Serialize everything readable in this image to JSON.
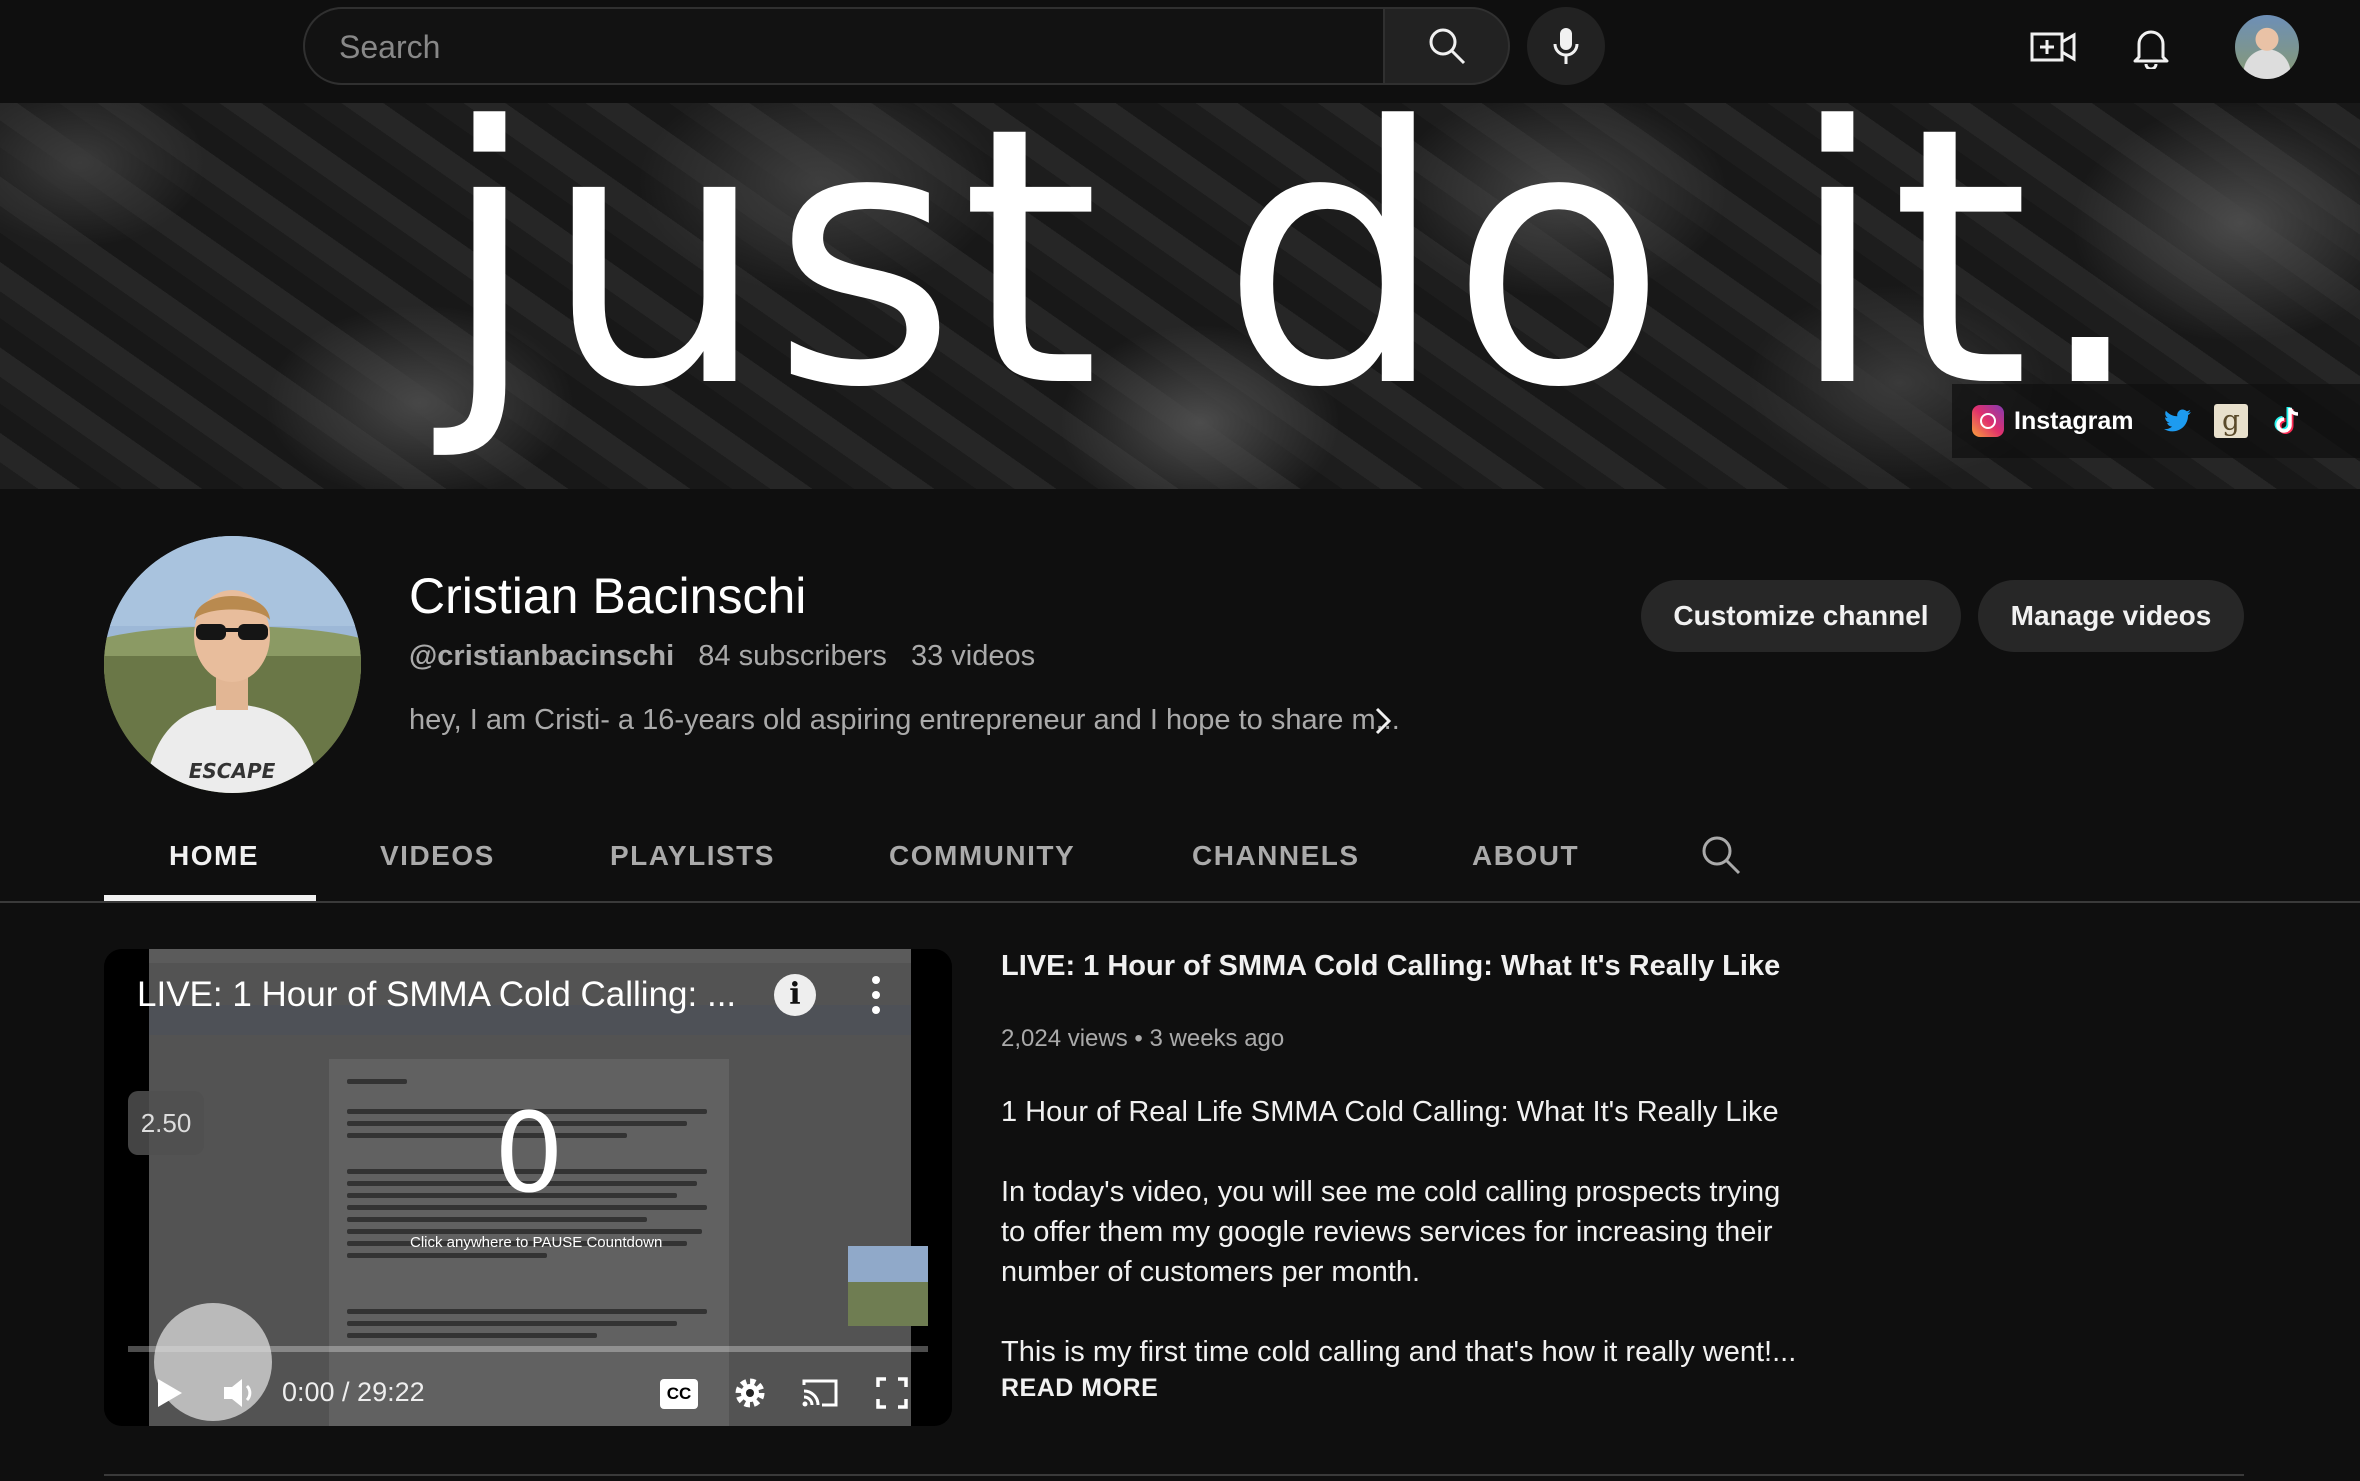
{
  "topbar": {
    "search_placeholder": "Search",
    "icons": [
      "search-icon",
      "microphone-icon",
      "create-video-icon",
      "notifications-bell-icon",
      "account-avatar"
    ]
  },
  "banner": {
    "text": "just do it.",
    "links": {
      "instagram_label": "Instagram",
      "icons": [
        "instagram-icon",
        "twitter-icon",
        "goodreads-icon",
        "tiktok-icon"
      ]
    }
  },
  "channel": {
    "name": "Cristian Bacinschi",
    "handle": "@cristianbacinschi",
    "subscribers": "84 subscribers",
    "videos": "33 videos",
    "description": "hey, I am Cristi- a 16-years old aspiring entrepreneur and I hope to share m...",
    "avatar_shirt_text": "ESCAPE",
    "customize_label": "Customize channel",
    "manage_label": "Manage videos"
  },
  "tabs": {
    "items": [
      "HOME",
      "VIDEOS",
      "PLAYLISTS",
      "COMMUNITY",
      "CHANNELS",
      "ABOUT"
    ],
    "active": "HOME"
  },
  "player": {
    "title": "LIVE: 1 Hour of SMMA Cold Calling: ...",
    "info_glyph": "i",
    "rate": "2.50",
    "countdown": "0",
    "countdown_hint": "Click anywhere to PAUSE Countdown",
    "time": "0:00 / 29:22",
    "cc_label": "CC",
    "progress": 0
  },
  "video": {
    "title": "LIVE: 1 Hour of SMMA Cold Calling: What It's Really Like",
    "views": "2,024 views",
    "separator": "•",
    "age": "3 weeks ago",
    "desc_line1": "1 Hour of Real Life SMMA Cold Calling: What It's Really Like",
    "desc_para2": "In today's video, you will see me cold calling prospects trying to offer them my google reviews services for increasing their number of customers per month.",
    "desc_para3": "This is my first time cold calling and that's how it really went!...",
    "read_more": "READ MORE"
  },
  "colors": {
    "background": "#0f0f0f",
    "button_bg": "#272727",
    "text_primary": "#f1f1f1",
    "text_secondary": "#aaaaaa"
  }
}
